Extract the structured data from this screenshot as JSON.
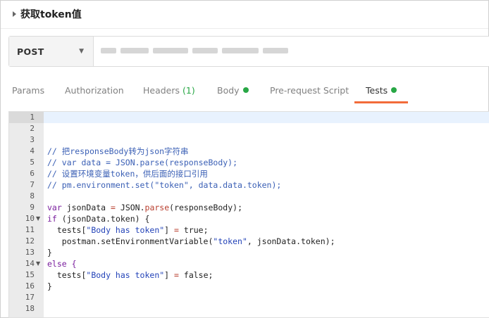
{
  "header": {
    "title": "获取token值"
  },
  "request": {
    "method": "POST"
  },
  "tabs": [
    {
      "label": "Params"
    },
    {
      "label": "Authorization"
    },
    {
      "label": "Headers",
      "count": "(1)"
    },
    {
      "label": "Body"
    },
    {
      "label": "Pre-request Script"
    },
    {
      "label": "Tests"
    }
  ],
  "colors": {
    "accent": "#f26b3a",
    "status_dot": "#28a745",
    "comment": "#3a5fb5"
  },
  "editor": {
    "line_numbers": [
      "1",
      "2",
      "3",
      "4",
      "5",
      "6",
      "7",
      "8",
      "9",
      "10",
      "11",
      "12",
      "13",
      "14",
      "15",
      "16",
      "17",
      "18"
    ],
    "lines": {
      "l4": "// 把responseBody转为json字符串",
      "l5": "// var data = JSON.parse(responseBody);",
      "l6": "// 设置环境变量token，供后面的接口引用",
      "l7": "// pm.environment.set(\"token\", data.data.token);",
      "l9_a": "var",
      "l9_b": " jsonData ",
      "l9_c": "=",
      "l9_d": " JSON.",
      "l9_e": "parse",
      "l9_f": "(responseBody);",
      "l10_a": "if",
      "l10_b": " (jsonData.token) {",
      "l11_a": "  tests[",
      "l11_b": "\"Body has token\"",
      "l11_c": "] ",
      "l11_d": "=",
      "l11_e": " true;",
      "l12_a": "   postman.setEnvironmentVariable(",
      "l12_b": "\"token\"",
      "l12_c": ", jsonData.token);",
      "l13": "}",
      "l14": "else {",
      "l15_a": "  tests[",
      "l15_b": "\"Body has token\"",
      "l15_c": "] ",
      "l15_d": "=",
      "l15_e": " false;",
      "l16": "}"
    }
  }
}
